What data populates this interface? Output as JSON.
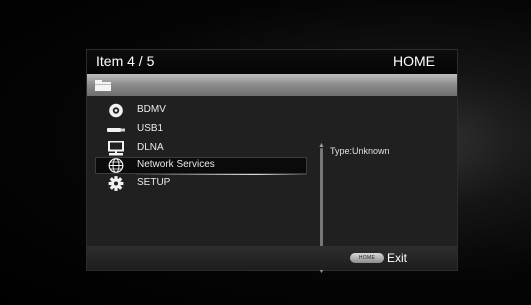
{
  "header": {
    "item_counter": "Item 4 / 5",
    "title": "HOME"
  },
  "pathbar": {
    "icon": "folder-icon"
  },
  "menu": {
    "items": [
      {
        "label": "BDMV",
        "icon": "disc-icon",
        "selected": false
      },
      {
        "label": "USB1",
        "icon": "usb-icon",
        "selected": false
      },
      {
        "label": "DLNA",
        "icon": "network-pc-icon",
        "selected": false
      },
      {
        "label": "Network Services",
        "icon": "globe-icon",
        "selected": true
      },
      {
        "label": "SETUP",
        "icon": "gear-icon",
        "selected": false
      }
    ]
  },
  "info": {
    "type_text": "Type:Unknown"
  },
  "footer": {
    "home_badge": "HOME",
    "exit_label": "Exit"
  },
  "colors": {
    "window_bg": "#1b1b1b",
    "pathbar": "#9a9a9a",
    "text": "#eaeaea"
  }
}
